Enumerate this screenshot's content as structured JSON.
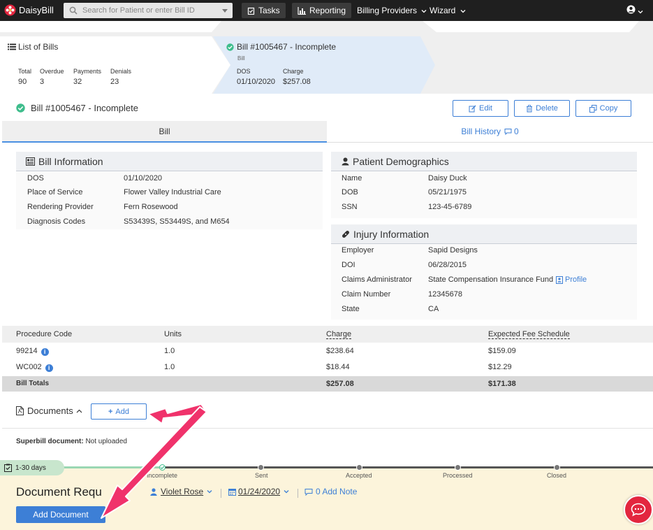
{
  "nav": {
    "brand": "DaisyBill",
    "search_placeholder": "Search for Patient or enter Bill ID",
    "tasks": "Tasks",
    "reporting": "Reporting",
    "billing_providers": "Billing Providers",
    "wizard": "Wizard"
  },
  "summary": {
    "list_title": "List of Bills",
    "stats": [
      {
        "label": "Total",
        "value": "90"
      },
      {
        "label": "Overdue",
        "value": "3"
      },
      {
        "label": "Payments",
        "value": "32"
      },
      {
        "label": "Denials",
        "value": "23"
      }
    ],
    "bill_title": "Bill #1005467 - Incomplete",
    "bill_sub": "Bill",
    "dos_label": "DOS",
    "dos_value": "01/10/2020",
    "charge_label": "Charge",
    "charge_value": "$257.08"
  },
  "header": {
    "title": "Bill #1005467 - Incomplete",
    "edit": "Edit",
    "delete": "Delete",
    "copy": "Copy"
  },
  "tabs": {
    "bill": "Bill",
    "history": "Bill History",
    "history_count": "0"
  },
  "bill_info": {
    "title": "Bill Information",
    "rows": [
      {
        "label": "DOS",
        "value": "01/10/2020"
      },
      {
        "label": "Place of Service",
        "value": "Flower Valley Industrial Care"
      },
      {
        "label": "Rendering Provider",
        "value": "Fern Rosewood"
      },
      {
        "label": "Diagnosis Codes",
        "value": "S53439S, S53449S, and M654"
      }
    ]
  },
  "patient": {
    "title": "Patient Demographics",
    "rows": [
      {
        "label": "Name",
        "value": "Daisy Duck"
      },
      {
        "label": "DOB",
        "value": "05/21/1975"
      },
      {
        "label": "SSN",
        "value": "123-45-6789"
      }
    ]
  },
  "injury": {
    "title": "Injury Information",
    "rows": [
      {
        "label": "Employer",
        "value": "Sapid Designs"
      },
      {
        "label": "DOI",
        "value": "06/28/2015"
      },
      {
        "label": "Claims Administrator",
        "value": "State Compensation Insurance Fund"
      },
      {
        "label": "Claim Number",
        "value": "12345678"
      },
      {
        "label": "State",
        "value": "CA"
      }
    ],
    "profile_link": "Profile"
  },
  "procedures": {
    "headers": [
      "Procedure Code",
      "Units",
      "Charge",
      "Expected Fee Schedule"
    ],
    "rows": [
      {
        "code": "99214",
        "units": "1.0",
        "charge": "$238.64",
        "expected": "$159.09"
      },
      {
        "code": "WC002",
        "units": "1.0",
        "charge": "$18.44",
        "expected": "$12.29"
      }
    ],
    "totals": {
      "label": "Bill Totals",
      "charge": "$257.08",
      "expected": "$171.38"
    }
  },
  "documents": {
    "title": "Documents",
    "add": "Add",
    "superbill_label": "Superbill document:",
    "superbill_value": "Not uploaded"
  },
  "timeline": {
    "badge": "1-30 days",
    "steps": [
      "Incomplete",
      "Sent",
      "Accepted",
      "Processed",
      "Closed"
    ]
  },
  "doc_request": {
    "title": "Document Requ",
    "assignee": "Violet Rose",
    "date": "01/24/2020",
    "note": "0 Add Note",
    "add_document": "Add Document"
  },
  "colors": {
    "accent": "#3d7fd6",
    "annotation_arrow": "#f0326b",
    "success": "#3ebd8c",
    "request_bg": "#fcf4db"
  }
}
